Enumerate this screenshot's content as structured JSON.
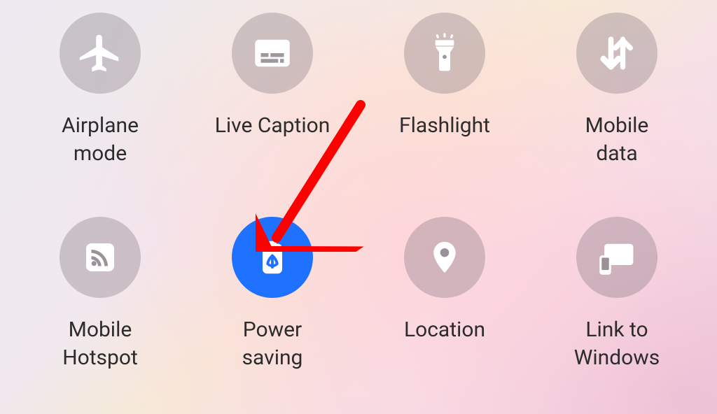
{
  "quick_settings": {
    "tiles": [
      {
        "id": "airplane",
        "label": "Airplane\nmode",
        "icon": "airplane-icon",
        "active": false
      },
      {
        "id": "live-caption",
        "label": "Live Caption",
        "icon": "caption-icon",
        "active": false
      },
      {
        "id": "flashlight",
        "label": "Flashlight",
        "icon": "flashlight-icon",
        "active": false
      },
      {
        "id": "mobile-data",
        "label": "Mobile\ndata",
        "icon": "data-arrows-icon",
        "active": false
      },
      {
        "id": "hotspot",
        "label": "Mobile\nHotspot",
        "icon": "hotspot-icon",
        "active": false
      },
      {
        "id": "power-saving",
        "label": "Power\nsaving",
        "icon": "battery-saver-icon",
        "active": true
      },
      {
        "id": "location",
        "label": "Location",
        "icon": "location-pin-icon",
        "active": false
      },
      {
        "id": "link-windows",
        "label": "Link to\nWindows",
        "icon": "link-windows-icon",
        "active": false
      }
    ],
    "colors": {
      "active_bg": "#1f72ff",
      "inactive_bg": "rgba(120,110,118,.32)",
      "label": "#2c2c2c"
    }
  },
  "annotation": {
    "arrow_points_to": "power-saving",
    "arrow_color": "#ff0000"
  }
}
